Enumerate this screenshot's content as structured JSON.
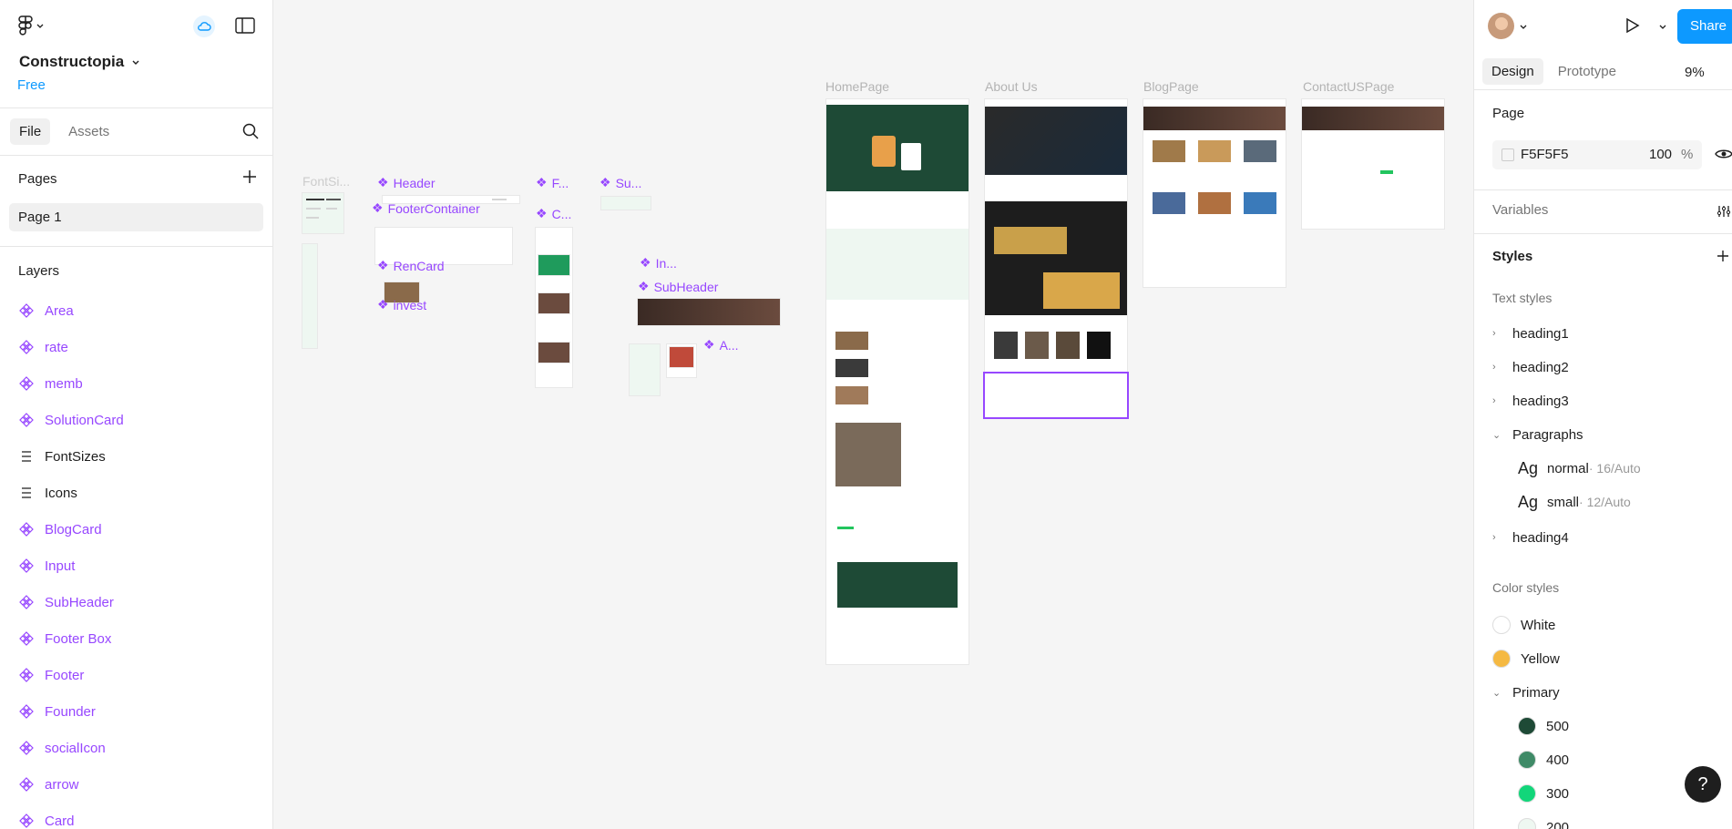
{
  "file": {
    "name": "Constructopia",
    "plan": "Free"
  },
  "left_tabs": [
    "File",
    "Assets"
  ],
  "pages": {
    "title": "Pages",
    "items": [
      "Page 1"
    ]
  },
  "layers": {
    "title": "Layers",
    "items": [
      {
        "name": "Area",
        "type": "component"
      },
      {
        "name": "rate",
        "type": "component"
      },
      {
        "name": "memb",
        "type": "component"
      },
      {
        "name": "SolutionCard",
        "type": "component"
      },
      {
        "name": "FontSizes",
        "type": "frame"
      },
      {
        "name": "Icons",
        "type": "frame"
      },
      {
        "name": "BlogCard",
        "type": "component"
      },
      {
        "name": "Input",
        "type": "component"
      },
      {
        "name": "SubHeader",
        "type": "component"
      },
      {
        "name": "Footer Box",
        "type": "component"
      },
      {
        "name": "Footer",
        "type": "component"
      },
      {
        "name": "Founder",
        "type": "component"
      },
      {
        "name": "socialIcon",
        "type": "component"
      },
      {
        "name": "arrow",
        "type": "component"
      },
      {
        "name": "Card",
        "type": "component"
      }
    ]
  },
  "canvas": {
    "frame_labels": [
      "HomePage",
      "About Us",
      "BlogPage",
      "ContactUSPage",
      "FontSi..."
    ],
    "component_labels": [
      "Header",
      "FooterContainer",
      "RenCard",
      "invest",
      "F...",
      "C...",
      "Su...",
      "In...",
      "SubHeader",
      "A..."
    ]
  },
  "right": {
    "share": "Share",
    "tabs": [
      "Design",
      "Prototype"
    ],
    "zoom": "9%",
    "page_title": "Page",
    "bg_hex": "F5F5F5",
    "bg_opacity": "100",
    "bg_pct": "%",
    "variables": "Variables",
    "styles": "Styles",
    "text_styles_title": "Text styles",
    "text_styles": [
      "heading1",
      "heading2",
      "heading3",
      "Paragraphs"
    ],
    "paragraph_styles": [
      {
        "glyph": "Ag",
        "name": "normal",
        "meta": " · 16/Auto"
      },
      {
        "glyph": "Ag",
        "name": "small",
        "meta": " · 12/Auto"
      }
    ],
    "text_style_last": "heading4",
    "color_styles_title": "Color styles",
    "colors": [
      {
        "name": "White",
        "hex": "#ffffff"
      },
      {
        "name": "Yellow",
        "hex": "#f5b942"
      }
    ],
    "primary_group": "Primary",
    "primary_shades": [
      {
        "name": "500",
        "hex": "#1e4a36"
      },
      {
        "name": "400",
        "hex": "#3f8a67"
      },
      {
        "name": "300",
        "hex": "#12d67a"
      },
      {
        "name": "200",
        "hex": "#eef7f1"
      }
    ]
  },
  "help": "?"
}
